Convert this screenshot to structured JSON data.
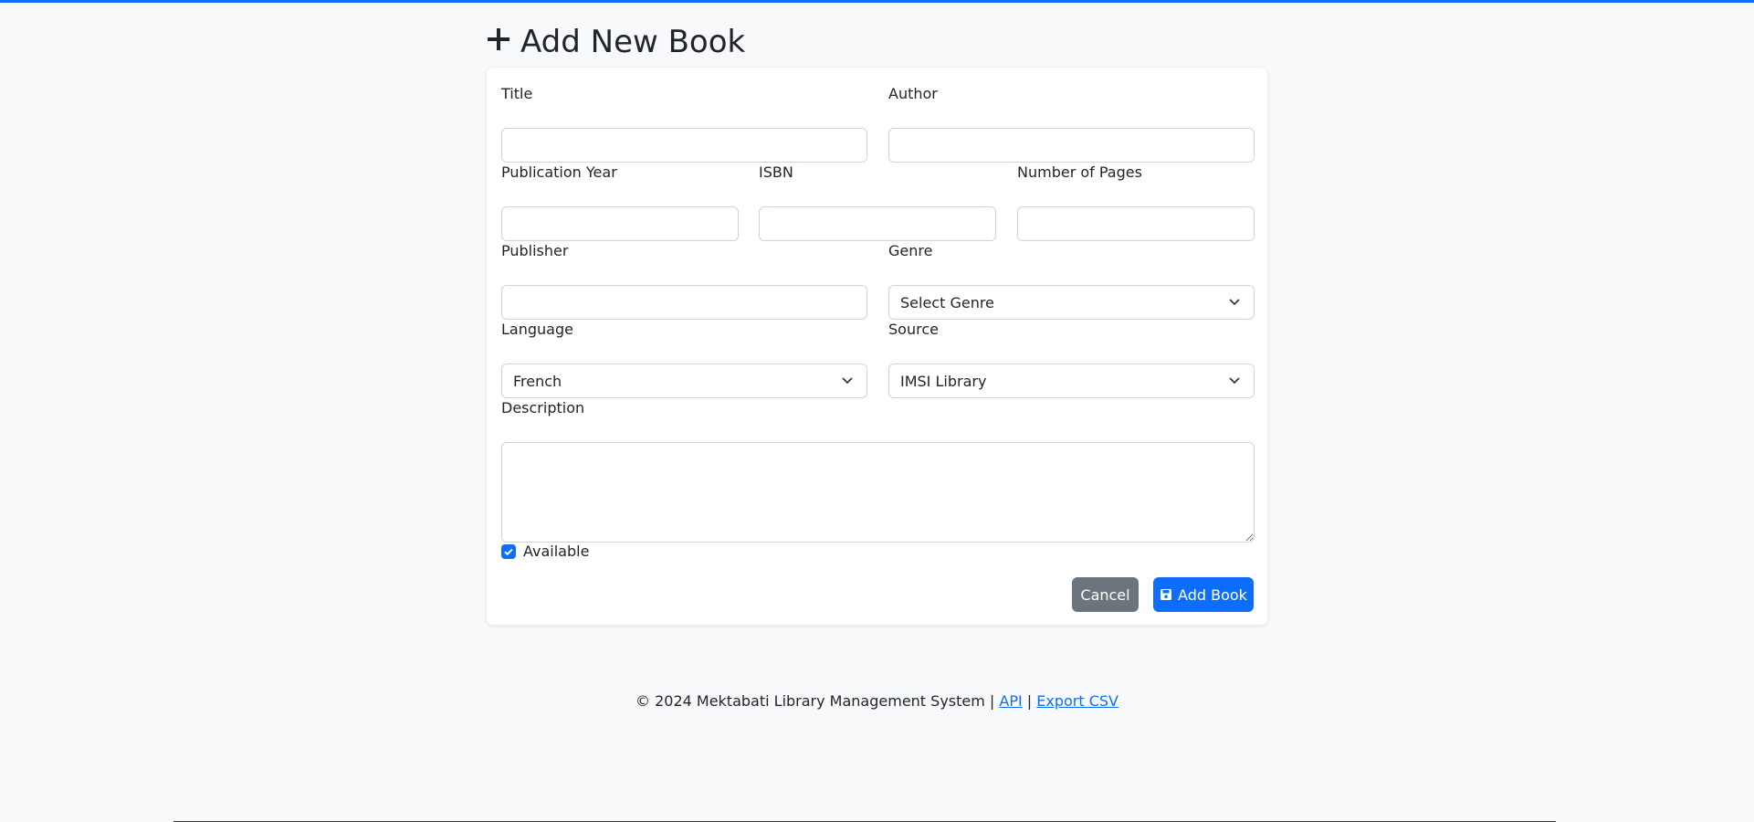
{
  "page": {
    "title": "Add New Book",
    "title_icon": "plus-icon"
  },
  "form": {
    "title_label": "Title",
    "title_value": "",
    "author_label": "Author",
    "author_value": "",
    "year_label": "Publication Year",
    "year_value": "",
    "isbn_label": "ISBN",
    "isbn_value": "",
    "pages_label": "Number of Pages",
    "pages_value": "",
    "publisher_label": "Publisher",
    "publisher_value": "",
    "genre_label": "Genre",
    "genre_value": "Select Genre",
    "language_label": "Language",
    "language_value": "French",
    "source_label": "Source",
    "source_value": "IMSI Library",
    "description_label": "Description",
    "description_value": "",
    "available_label": "Available",
    "available_checked": true
  },
  "actions": {
    "cancel_label": "Cancel",
    "add_label": "Add Book",
    "add_icon": "save-icon"
  },
  "footer": {
    "text": "© 2024 Mektabati Library Management System | ",
    "api_link": "API",
    "separator": " | ",
    "export_link": "Export CSV"
  },
  "colors": {
    "primary": "#0d6efd",
    "secondary": "#6c757d",
    "background": "#f8f9fa"
  }
}
